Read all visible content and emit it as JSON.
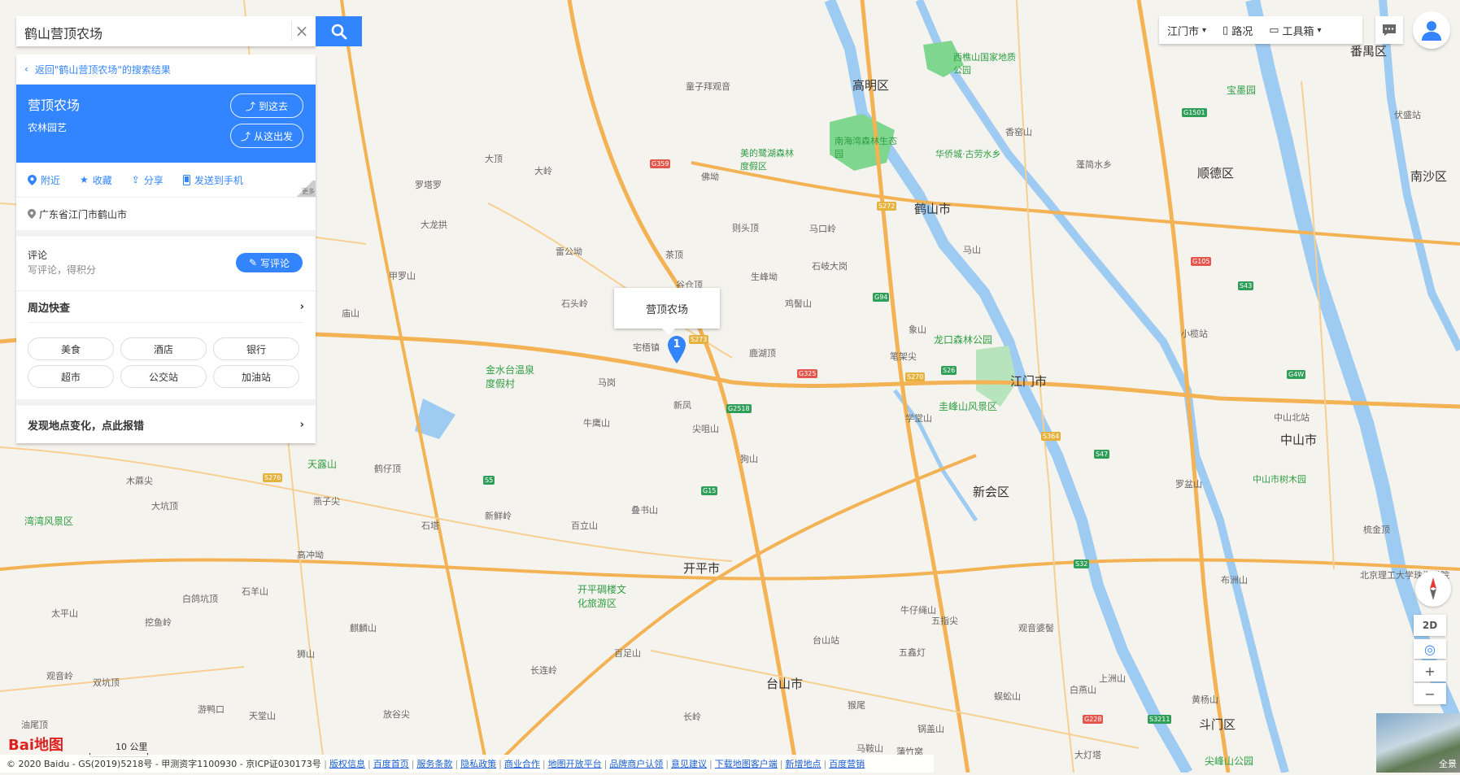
{
  "search": {
    "query": "鹤山营顶农场",
    "clear_icon": "close-icon",
    "button_icon": "search-icon"
  },
  "panel": {
    "back_label": "返回\"鹤山营顶农场\"的搜索结果",
    "poi": {
      "name": "营顶农场",
      "category": "农林园艺",
      "goto_label": "到这去",
      "from_label": "从这出发"
    },
    "actions": [
      {
        "label": "附近",
        "icon": "location-icon"
      },
      {
        "label": "收藏",
        "icon": "star-icon"
      },
      {
        "label": "分享",
        "icon": "share-icon"
      },
      {
        "label": "发送到手机",
        "icon": "phone-icon"
      }
    ],
    "fold_label": "更多",
    "address": "广东省江门市鹤山市",
    "review": {
      "title": "评论",
      "subtitle": "写评论，得积分",
      "button": "写评论"
    },
    "nearby": {
      "title": "周边快查",
      "chips": [
        "美食",
        "酒店",
        "银行",
        "超市",
        "公交站",
        "加油站"
      ]
    },
    "report_label": "发现地点变化，点此报错"
  },
  "topbar": {
    "city": "江门市",
    "traffic": "路况",
    "toolbox": "工具箱"
  },
  "map": {
    "popup_label": "营顶农场",
    "marker_number": "1",
    "labels": [
      {
        "t": "鹤山市",
        "c": "city"
      },
      {
        "t": "江门市",
        "c": "city"
      },
      {
        "t": "开平市",
        "c": "city"
      },
      {
        "t": "台山市",
        "c": "city"
      },
      {
        "t": "新会区",
        "c": "city"
      },
      {
        "t": "中山市",
        "c": "city"
      },
      {
        "t": "顺德区",
        "c": "city"
      },
      {
        "t": "高明区",
        "c": "city"
      },
      {
        "t": "番禺区",
        "c": "city"
      },
      {
        "t": "南沙区",
        "c": "city"
      },
      {
        "t": "斗门区",
        "c": "city"
      },
      {
        "t": "龙口森林公园",
        "c": "park"
      },
      {
        "t": "圭峰山风景区",
        "c": "park"
      },
      {
        "t": "金水台温泉度假村",
        "c": "park"
      },
      {
        "t": "西樵山国家地质公园",
        "c": "park"
      },
      {
        "t": "南海湾森林生态园",
        "c": "park"
      },
      {
        "t": "美的鹭湖森林度假区",
        "c": "park"
      },
      {
        "t": "开平碉楼文化旅游区",
        "c": "park"
      },
      {
        "t": "华侨城·古劳水乡",
        "c": "park"
      },
      {
        "t": "天露山",
        "c": "park"
      },
      {
        "t": "宅梧镇",
        "c": "town"
      },
      {
        "t": "马岗",
        "c": "town"
      },
      {
        "t": "新凤",
        "c": "town"
      },
      {
        "t": "尖咀山",
        "c": "town"
      },
      {
        "t": "鹿湖顶",
        "c": "town"
      },
      {
        "t": "鸡髻山",
        "c": "town"
      },
      {
        "t": "谷仓顶",
        "c": "town"
      },
      {
        "t": "生峰坳",
        "c": "town"
      },
      {
        "t": "茶顶",
        "c": "town"
      },
      {
        "t": "雷公坳",
        "c": "town"
      },
      {
        "t": "石头岭",
        "c": "town"
      },
      {
        "t": "牛鹰山",
        "c": "town"
      },
      {
        "t": "狗山",
        "c": "town"
      },
      {
        "t": "叠书山",
        "c": "town"
      },
      {
        "t": "百立山",
        "c": "town"
      },
      {
        "t": "新鲜岭",
        "c": "town"
      },
      {
        "t": "石塔",
        "c": "town"
      },
      {
        "t": "鹤仔顶",
        "c": "town"
      },
      {
        "t": "学堂山",
        "c": "town"
      },
      {
        "t": "象山",
        "c": "town"
      },
      {
        "t": "笔架尖",
        "c": "town"
      },
      {
        "t": "马山",
        "c": "town"
      },
      {
        "t": "石岐大岗",
        "c": "town"
      },
      {
        "t": "马口岭",
        "c": "town"
      },
      {
        "t": "则头顶",
        "c": "town"
      },
      {
        "t": "佛坳",
        "c": "town"
      },
      {
        "t": "大岭",
        "c": "town"
      },
      {
        "t": "大顶",
        "c": "town"
      },
      {
        "t": "罗塔罗",
        "c": "town"
      },
      {
        "t": "大龙拱",
        "c": "town"
      },
      {
        "t": "甲罗山",
        "c": "town"
      },
      {
        "t": "庙山",
        "c": "town"
      },
      {
        "t": "童子拜观音",
        "c": "town"
      },
      {
        "t": "五指尖",
        "c": "town"
      },
      {
        "t": "牛仔绳山",
        "c": "town"
      },
      {
        "t": "五鑫灯",
        "c": "town"
      },
      {
        "t": "观音婆髻",
        "c": "town"
      },
      {
        "t": "上洲山",
        "c": "town"
      },
      {
        "t": "白燕山",
        "c": "town"
      },
      {
        "t": "黄杨山",
        "c": "town"
      },
      {
        "t": "布洲山",
        "c": "town"
      },
      {
        "t": "蜈蚣山",
        "c": "town"
      },
      {
        "t": "锅盖山",
        "c": "town"
      },
      {
        "t": "长岭",
        "c": "town"
      },
      {
        "t": "台山站",
        "c": "town"
      },
      {
        "t": "百足山",
        "c": "town"
      },
      {
        "t": "长连岭",
        "c": "town"
      },
      {
        "t": "麒麟山",
        "c": "town"
      },
      {
        "t": "狮山",
        "c": "town"
      },
      {
        "t": "放谷尖",
        "c": "town"
      },
      {
        "t": "游鸭口",
        "c": "town"
      },
      {
        "t": "天堂山",
        "c": "town"
      },
      {
        "t": "挖鱼岭",
        "c": "town"
      },
      {
        "t": "观音岭",
        "c": "town"
      },
      {
        "t": "双坑顶",
        "c": "town"
      },
      {
        "t": "白鸽坑顶",
        "c": "town"
      },
      {
        "t": "石羊山",
        "c": "town"
      },
      {
        "t": "太平山",
        "c": "town"
      },
      {
        "t": "大坑顶",
        "c": "town"
      },
      {
        "t": "木蔴尖",
        "c": "town"
      },
      {
        "t": "燕子尖",
        "c": "town"
      },
      {
        "t": "高冲坳",
        "c": "town"
      },
      {
        "t": "油尾顶",
        "c": "town"
      },
      {
        "t": "中山北站",
        "c": "town"
      },
      {
        "t": "中山市树木园",
        "c": "park"
      },
      {
        "t": "梳金顶",
        "c": "town"
      },
      {
        "t": "北京理工大学珠海学院",
        "c": "town"
      },
      {
        "t": "小榄站",
        "c": "town"
      },
      {
        "t": "香窑山",
        "c": "town"
      },
      {
        "t": "蓬简水乡",
        "c": "town"
      },
      {
        "t": "宝墨园",
        "c": "park"
      },
      {
        "t": "伏盛站",
        "c": "town"
      },
      {
        "t": "湾湾风景区",
        "c": "park"
      },
      {
        "t": "罗盆山",
        "c": "town"
      },
      {
        "t": "马鞍山",
        "c": "town"
      },
      {
        "t": "大灯塔",
        "c": "town"
      },
      {
        "t": "尖峰山公园",
        "c": "park"
      },
      {
        "t": "蒲竹窝",
        "c": "town"
      },
      {
        "t": "猴尾",
        "c": "town"
      }
    ],
    "shields": [
      {
        "t": "G94",
        "c": "g"
      },
      {
        "t": "G15",
        "c": "g"
      },
      {
        "t": "G2518",
        "c": "g"
      },
      {
        "t": "S5",
        "c": "g"
      },
      {
        "t": "G325",
        "c": "r"
      },
      {
        "t": "S270",
        "c": "s"
      },
      {
        "t": "S26",
        "c": "g"
      },
      {
        "t": "S273",
        "c": "s"
      },
      {
        "t": "G359",
        "c": "r"
      },
      {
        "t": "S272",
        "c": "s"
      },
      {
        "t": "S43",
        "c": "g"
      },
      {
        "t": "G1501",
        "c": "g"
      },
      {
        "t": "G4W",
        "c": "g"
      },
      {
        "t": "G105",
        "c": "r"
      },
      {
        "t": "S364",
        "c": "s"
      },
      {
        "t": "S47",
        "c": "g"
      },
      {
        "t": "S32",
        "c": "g"
      },
      {
        "t": "S3211",
        "c": "g"
      },
      {
        "t": "G228",
        "c": "r"
      },
      {
        "t": "S276",
        "c": "s"
      }
    ]
  },
  "controls": {
    "zoom_in": "+",
    "zoom_out": "−",
    "view_2d": "2D",
    "panorama": "全景"
  },
  "bottom": {
    "logo_text": "Bai地图",
    "scale_label": "10 公里",
    "copyright": "© 2020 Baidu - GS(2019)5218号 - 甲测资字1100930 - 京ICP证030173号",
    "links": [
      "版权信息",
      "百度首页",
      "服务条款",
      "隐私政策",
      "商业合作",
      "地图开放平台",
      "品牌商户认领",
      "意见建议",
      "下载地图客户端",
      "新增地点",
      "百度营销"
    ]
  }
}
